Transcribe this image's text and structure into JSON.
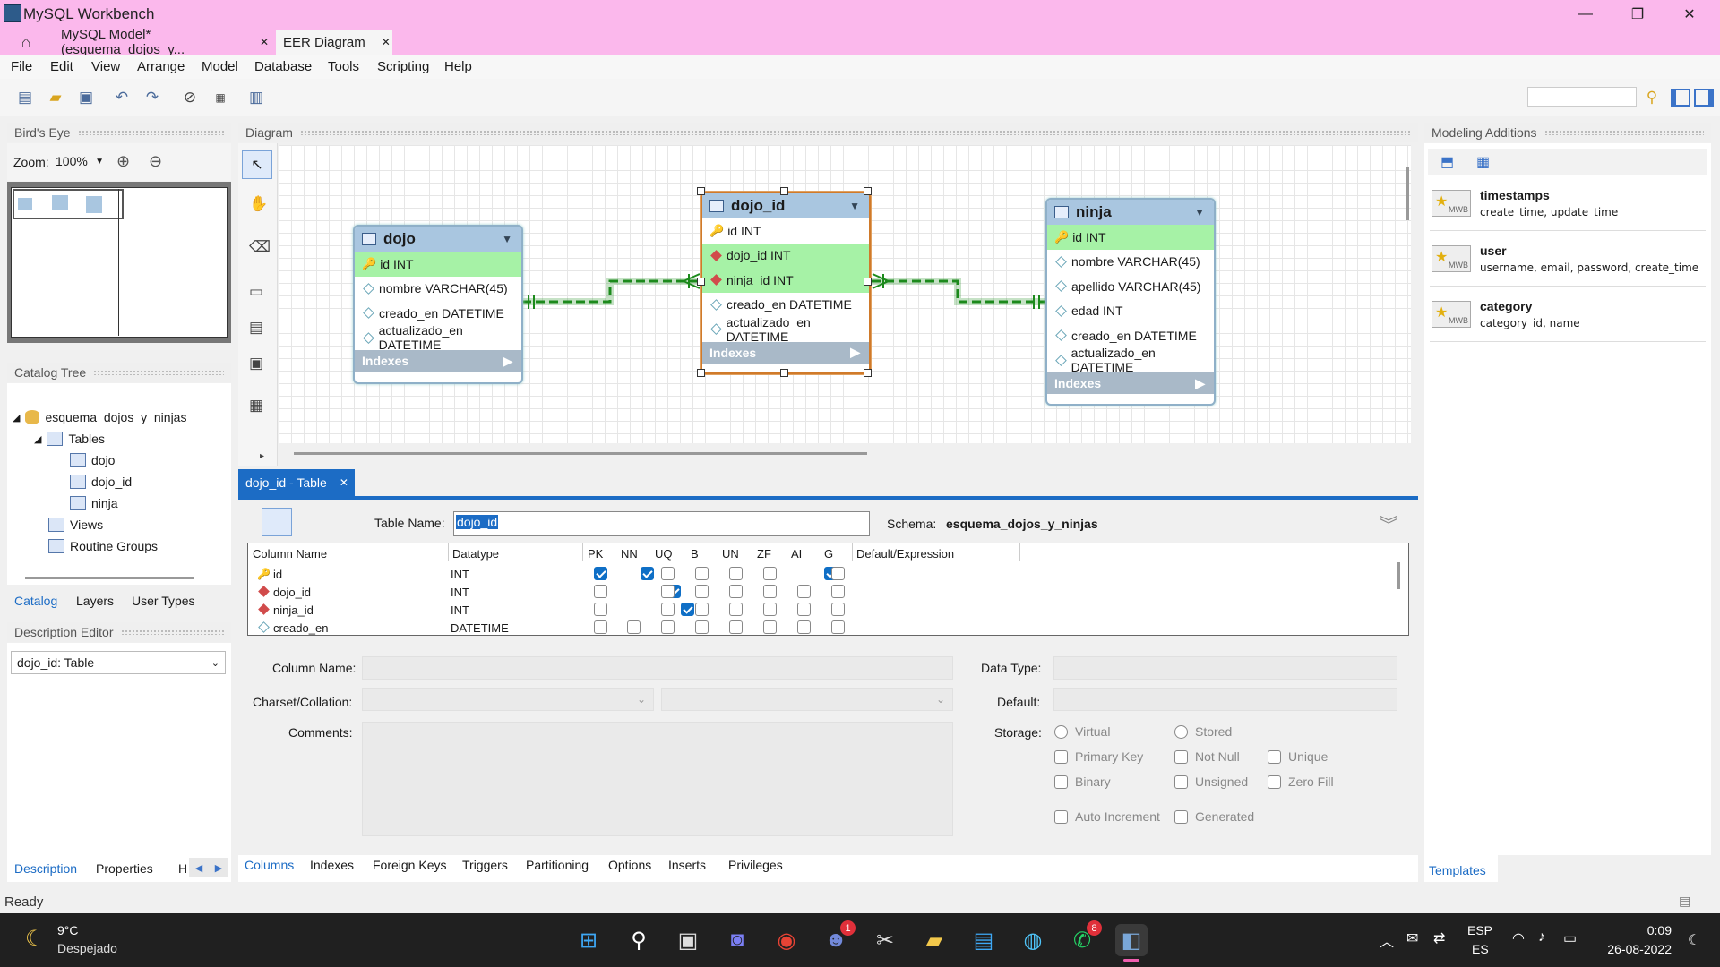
{
  "window": {
    "title": "MySQL Workbench",
    "minimize": "—",
    "maximize": "❐",
    "close": "✕"
  },
  "doc_tabs": [
    {
      "label": "MySQL Model* (esquema_dojos_y...",
      "close": "✕"
    },
    {
      "label": "EER Diagram",
      "close": "✕"
    }
  ],
  "menu": [
    "File",
    "Edit",
    "View",
    "Arrange",
    "Model",
    "Database",
    "Tools",
    "Scripting",
    "Help"
  ],
  "birds_eye": {
    "header": "Bird's Eye",
    "zoom_label": "Zoom:",
    "zoom_value": "100%"
  },
  "catalog": {
    "header": "Catalog Tree",
    "schema": "esquema_dojos_y_ninjas",
    "tables_label": "Tables",
    "tables": [
      "dojo",
      "dojo_id",
      "ninja"
    ],
    "views_label": "Views",
    "routines_label": "Routine Groups",
    "tabs": [
      "Catalog",
      "Layers",
      "User Types"
    ]
  },
  "description_editor": {
    "header": "Description Editor",
    "selected": "dojo_id: Table"
  },
  "left_bottom_tabs": [
    "Description",
    "Properties",
    "H"
  ],
  "diagram": {
    "header": "Diagram",
    "entities": {
      "dojo": {
        "name": "dojo",
        "columns": [
          "id INT",
          "nombre VARCHAR(45)",
          "creado_en DATETIME",
          "actualizado_en DATETIME"
        ],
        "indexes": "Indexes"
      },
      "dojo_id": {
        "name": "dojo_id",
        "columns": [
          "id INT",
          "dojo_id INT",
          "ninja_id INT",
          "creado_en DATETIME",
          "actualizado_en DATETIME"
        ],
        "indexes": "Indexes"
      },
      "ninja": {
        "name": "ninja",
        "columns": [
          "id INT",
          "nombre VARCHAR(45)",
          "apellido VARCHAR(45)",
          "edad INT",
          "creado_en DATETIME",
          "actualizado_en DATETIME"
        ],
        "indexes": "Indexes"
      }
    }
  },
  "modeling": {
    "header": "Modeling Additions",
    "items": [
      {
        "title": "timestamps",
        "desc": "create_time, update_time",
        "badge": "MWB"
      },
      {
        "title": "user",
        "desc": "username, email, password, create_time",
        "badge": "MWB"
      },
      {
        "title": "category",
        "desc": "category_id, name",
        "badge": "MWB"
      }
    ],
    "templates_tab": "Templates"
  },
  "editor": {
    "tab_label": "dojo_id - Table",
    "table_name_label": "Table Name:",
    "table_name": "dojo_id",
    "schema_label": "Schema:",
    "schema": "esquema_dojos_y_ninjas",
    "grid_headers": [
      "Column Name",
      "Datatype",
      "PK",
      "NN",
      "UQ",
      "B",
      "UN",
      "ZF",
      "AI",
      "G",
      "Default/Expression"
    ],
    "rows": [
      {
        "name": "id",
        "type": "INT",
        "flags": [
          1,
          1,
          0,
          0,
          0,
          0,
          1,
          0
        ],
        "kind": "pk"
      },
      {
        "name": "dojo_id",
        "type": "INT",
        "flags": [
          0,
          1,
          0,
          0,
          0,
          0,
          0,
          0
        ],
        "kind": "fk"
      },
      {
        "name": "ninja_id",
        "type": "INT",
        "flags": [
          0,
          1,
          0,
          0,
          0,
          0,
          0,
          0
        ],
        "kind": "fk"
      },
      {
        "name": "creado_en",
        "type": "DATETIME",
        "flags": [
          0,
          0,
          0,
          0,
          0,
          0,
          0,
          0
        ],
        "kind": "col"
      }
    ],
    "column_name_label": "Column Name:",
    "charset_label": "Charset/Collation:",
    "comments_label": "Comments:",
    "data_type_label": "Data Type:",
    "default_label": "Default:",
    "storage_label": "Storage:",
    "virtual": "Virtual",
    "stored": "Stored",
    "primary_key": "Primary Key",
    "not_null": "Not Null",
    "unique": "Unique",
    "binary": "Binary",
    "unsigned": "Unsigned",
    "zero_fill": "Zero Fill",
    "auto_increment": "Auto Increment",
    "generated": "Generated",
    "tabs": [
      "Columns",
      "Indexes",
      "Foreign Keys",
      "Triggers",
      "Partitioning",
      "Options",
      "Inserts",
      "Privileges"
    ]
  },
  "status": "Ready",
  "taskbar": {
    "weather_temp": "9°C",
    "weather_desc": "Despejado",
    "discord_badge": "1",
    "whatsapp_badge": "8",
    "lang_top": "ESP",
    "lang_bottom": "ES",
    "time": "0:09",
    "date": "26-08-2022"
  }
}
